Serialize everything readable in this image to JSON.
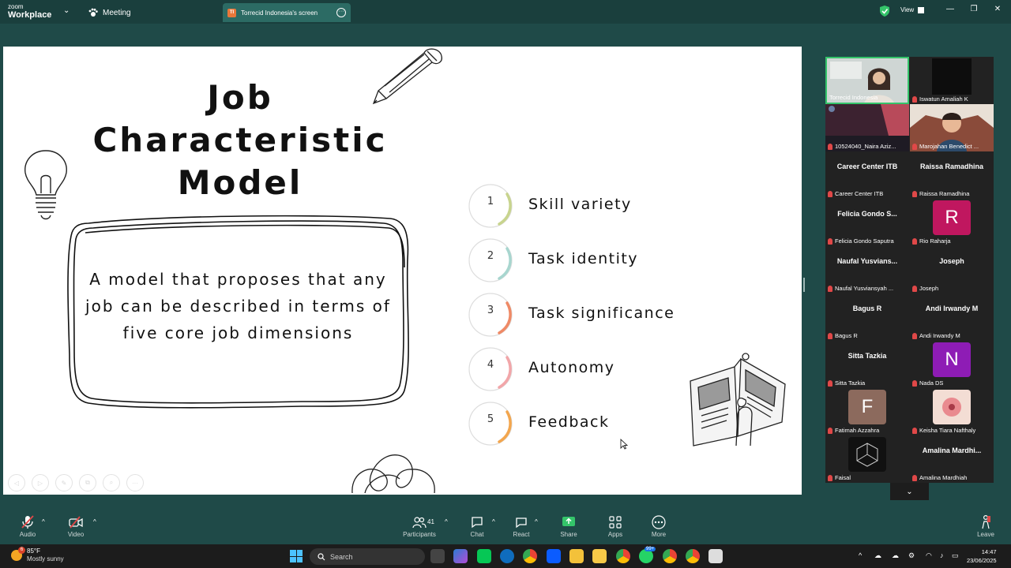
{
  "window": {
    "brand_line1": "zoom",
    "brand_line2": "Workplace",
    "meeting_tab": "Meeting",
    "screen_tab_initials": "TI",
    "screen_tab": "Torrecid Indonesia's screen",
    "view_label": "View"
  },
  "slide": {
    "title_lines": [
      "Job",
      "Characteristic",
      "Model"
    ],
    "definition": "A model that proposes that any job can be described in terms of five core job dimensions",
    "dimensions": [
      {
        "num": "1",
        "label": "Skill variety",
        "color": "#c8d48e"
      },
      {
        "num": "2",
        "label": "Task identity",
        "color": "#a8d6cf"
      },
      {
        "num": "3",
        "label": "Task significance",
        "color": "#ef8a66"
      },
      {
        "num": "4",
        "label": "Autonomy",
        "color": "#f2a6a9"
      },
      {
        "num": "5",
        "label": "Feedback",
        "color": "#f3a64e"
      }
    ]
  },
  "participants": [
    {
      "name": "",
      "label": "Torrecid Indonesia",
      "kind": "video-woman",
      "active": true,
      "muted": false
    },
    {
      "name": "",
      "label": "Iswatun Amaliah K",
      "kind": "video-dark",
      "muted": true
    },
    {
      "name": "",
      "label": "10524040_Naira Aziz...",
      "kind": "video-room",
      "muted": true
    },
    {
      "name": "",
      "label": "Marojahan Benedict ...",
      "kind": "video-avatar",
      "muted": true
    },
    {
      "name": "Career Center ITB",
      "label": "Career Center ITB",
      "muted": true
    },
    {
      "name": "Raissa Ramadhina",
      "label": "Raissa Ramadhina",
      "muted": true
    },
    {
      "name": "Felicia Gondo S...",
      "label": "Felicia Gondo Saputra",
      "muted": true
    },
    {
      "name": "",
      "label": "Rio Raharja",
      "avatar": "R",
      "avatar_color": "#c0175f",
      "muted": true
    },
    {
      "name": "Naufal Yusvians...",
      "label": "Naufal Yusviansyah ...",
      "muted": true
    },
    {
      "name": "Joseph",
      "label": "Joseph",
      "muted": true
    },
    {
      "name": "Bagus R",
      "label": "Bagus R",
      "muted": true
    },
    {
      "name": "Andi Irwandy M",
      "label": "Andi Irwandy M",
      "muted": true
    },
    {
      "name": "Sitta Tazkia",
      "label": "Sitta Tazkia",
      "muted": true
    },
    {
      "name": "",
      "label": "Nada DS",
      "avatar": "N",
      "avatar_color": "#8e1cb5",
      "muted": true
    },
    {
      "name": "",
      "label": "Fatimah Azzahra",
      "avatar": "F",
      "avatar_color": "#8c6a5d",
      "muted": true
    },
    {
      "name": "",
      "label": "Keisha Tiara Nafthaly",
      "kind": "photo-flower",
      "muted": true
    },
    {
      "name": "",
      "label": "Faisal",
      "kind": "photo-cube",
      "muted": true
    },
    {
      "name": "Amalina Mardhi...",
      "label": "Amalina Mardhiah",
      "muted": true
    }
  ],
  "toolbar": {
    "audio": "Audio",
    "video": "Video",
    "participants": "Participants",
    "participants_count": "41",
    "chat": "Chat",
    "react": "React",
    "share": "Share",
    "apps": "Apps",
    "more": "More",
    "leave": "Leave"
  },
  "taskbar": {
    "weather_badge": "6",
    "temperature": "85°F",
    "weather": "Mostly sunny",
    "search_placeholder": "Search",
    "notif_badge": "99+",
    "time": "14:47",
    "date": "23/06/2025"
  }
}
